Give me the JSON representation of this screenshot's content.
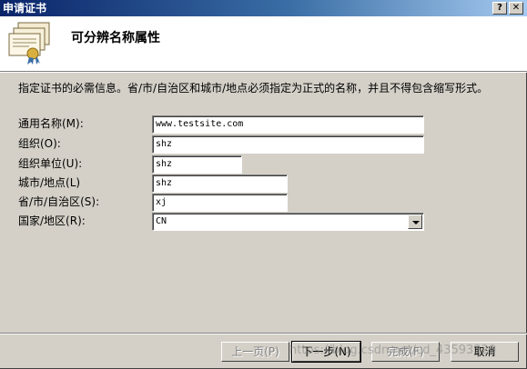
{
  "window": {
    "title": "申请证书",
    "help_glyph": "?",
    "close_glyph": "✕"
  },
  "header": {
    "icon": "certificate-stack-icon",
    "title": "可分辨名称属性"
  },
  "description": "指定证书的必需信息。省/市/自治区和城市/地点必须指定为正式的名称，并且不得包含缩写形式。",
  "fields": {
    "common_name": {
      "label": "通用名称(M):",
      "value": "www.testsite.com"
    },
    "organization": {
      "label": "组织(O):",
      "value": "shz"
    },
    "org_unit": {
      "label": "组织单位(U):",
      "value": "shz"
    },
    "city": {
      "label": "城市/地点(L)",
      "value": "shz"
    },
    "state": {
      "label": "省/市/自治区(S):",
      "value": "xj"
    },
    "country": {
      "label": "国家/地区(R):",
      "value": "CN"
    }
  },
  "buttons": {
    "back": "上一页(P)",
    "next": "下一步(N)",
    "finish": "完成(F)",
    "cancel": "取消"
  },
  "watermark": "https://blog.csdn.net/cd_43593320"
}
